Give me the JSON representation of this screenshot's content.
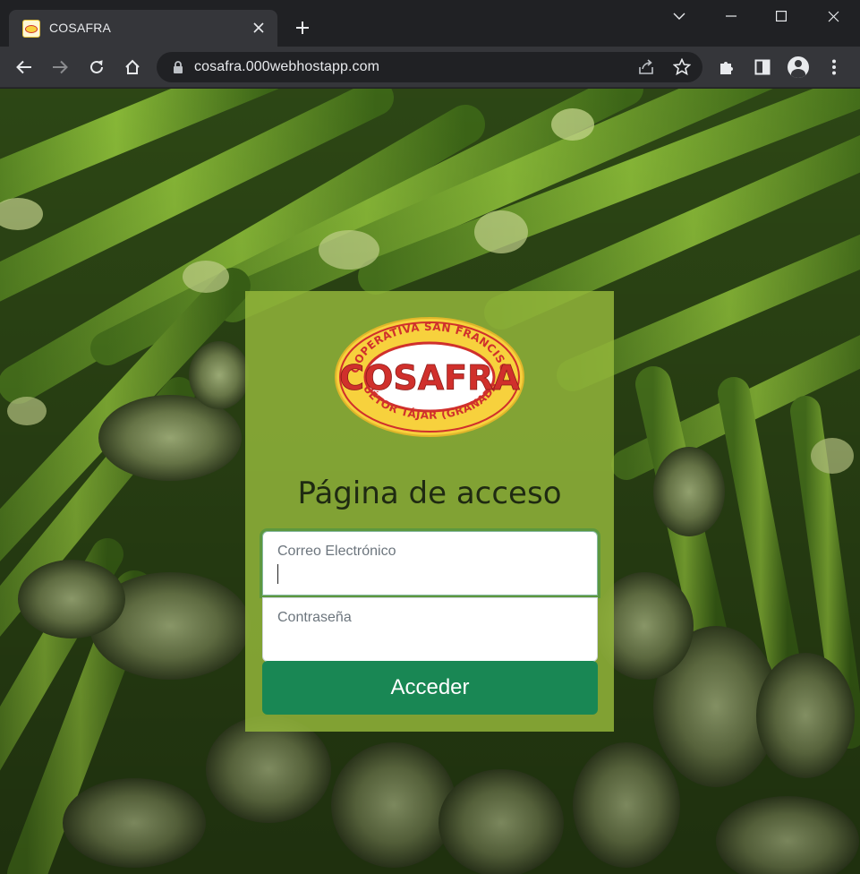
{
  "browser": {
    "tab_title": "COSAFRA",
    "url": "cosafra.000webhostapp.com"
  },
  "logo": {
    "top_text": "COOPERATIVA SAN FRANCISCO",
    "brand": "COSAFRA",
    "bottom_text": "HUÉTOR TÁJAR (GRANADA)"
  },
  "login": {
    "title": "Página de acceso",
    "email_label": "Correo Electrónico",
    "password_label": "Contraseña",
    "submit_label": "Acceder"
  },
  "colors": {
    "card": "#96ba3c",
    "button": "#198754",
    "logo_yellow": "#f7d13d",
    "logo_red": "#d0302c"
  }
}
